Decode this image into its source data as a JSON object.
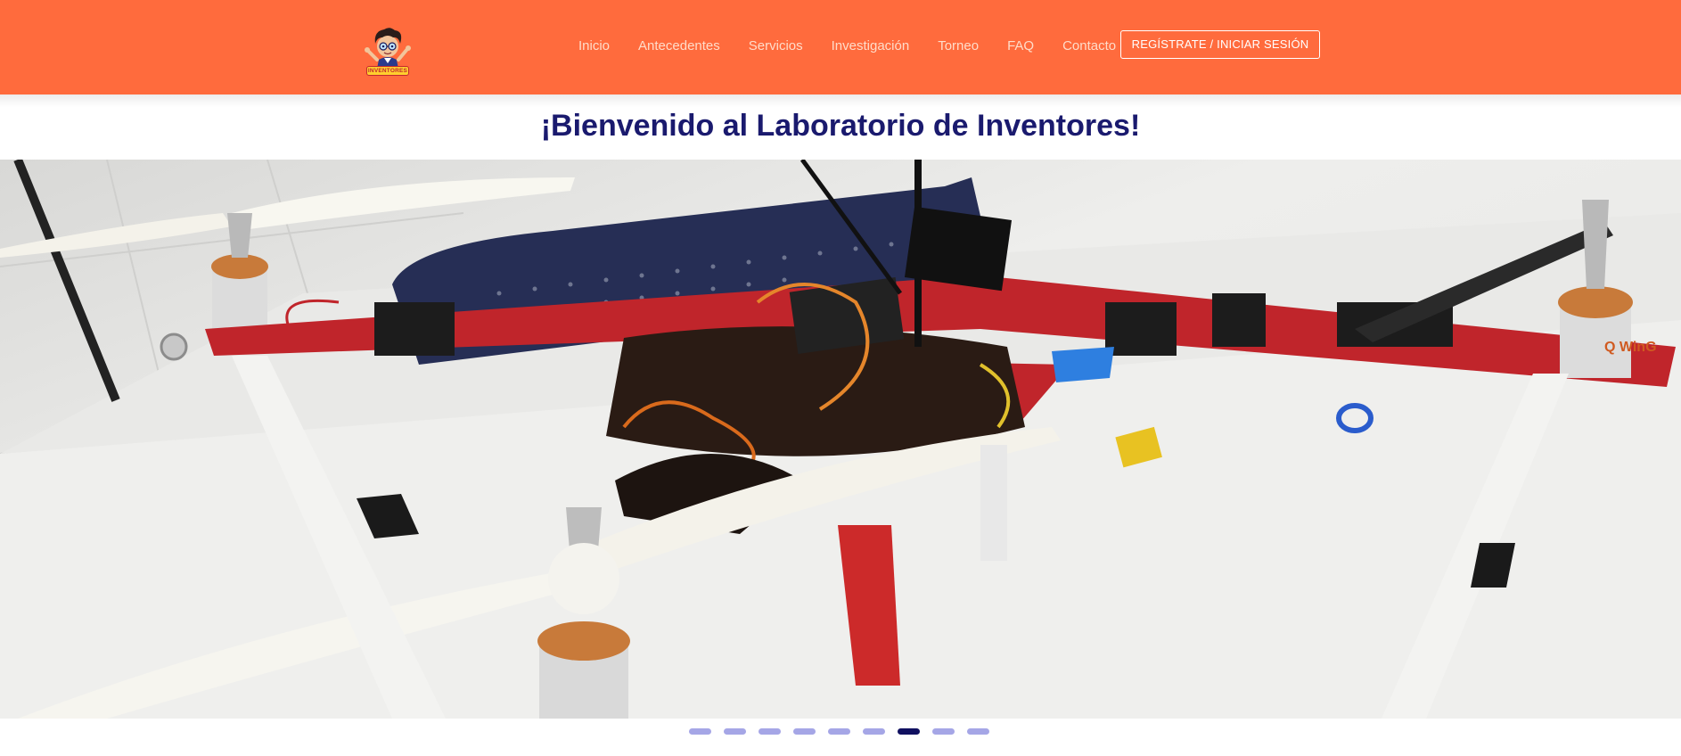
{
  "header": {
    "logo_text": "INVENTORES",
    "nav": [
      "Inicio",
      "Antecedentes",
      "Servicios",
      "Investigación",
      "Torneo",
      "FAQ",
      "Contacto"
    ],
    "register_label": "REGÍSTRATE / INICIAR SESIÓN"
  },
  "main": {
    "title": "¡Bienvenido al Laboratorio de Inventores!"
  },
  "carousel": {
    "slide_count": 9,
    "active_index": 6
  },
  "colors": {
    "header_bg": "#ff6b3d",
    "title_text": "#1a1a6e",
    "dot_inactive": "#a5a6e6",
    "dot_active": "#101060"
  }
}
